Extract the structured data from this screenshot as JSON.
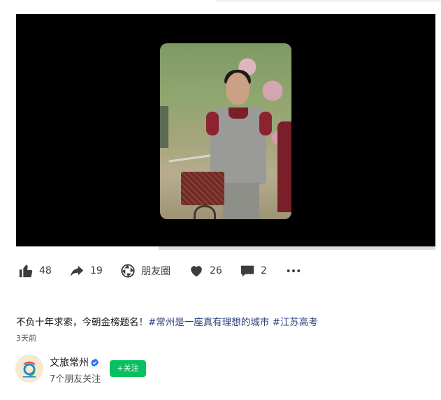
{
  "video": {
    "progress": 0.34
  },
  "actions": {
    "like": {
      "icon": "thumbs-up-icon",
      "count": "48"
    },
    "share": {
      "icon": "share-arrow-icon",
      "count": "19"
    },
    "moments": {
      "icon": "aperture-icon",
      "label": "朋友圈"
    },
    "favorite": {
      "icon": "heart-icon",
      "count": "26"
    },
    "comment": {
      "icon": "comment-bubble-icon",
      "count": "2"
    },
    "more": {
      "icon": "more-dots-icon"
    }
  },
  "post": {
    "text": "不负十年求索，今朝金榜题名！",
    "tag1": "#常州是一座真有理想的城市",
    "tag2": "#江苏高考",
    "time": "3天前"
  },
  "author": {
    "name": "文旅常州",
    "follow_label": "+关注",
    "followers": "7个朋友关注"
  },
  "colors": {
    "accent": "#07c160",
    "tag": "#2a3f7c",
    "verified": "#2f6fe4"
  }
}
